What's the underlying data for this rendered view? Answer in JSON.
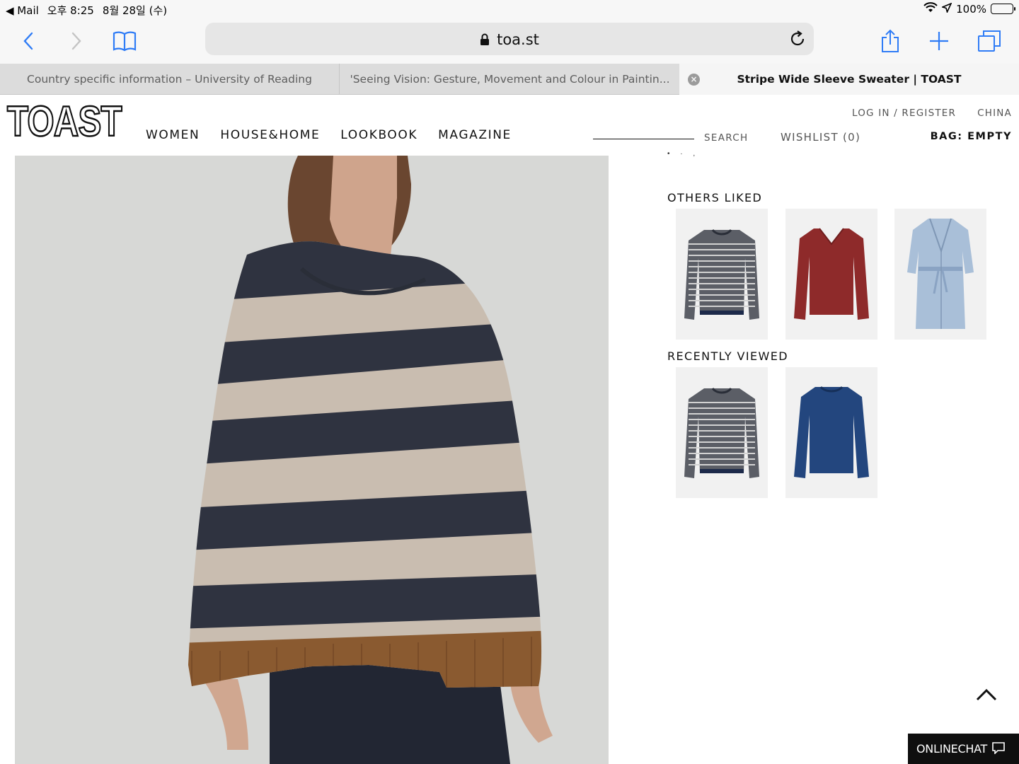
{
  "status_bar": {
    "back_app": "◀ Mail",
    "time": "오후 8:25",
    "date": "8월 28일 (수)",
    "battery": "100%"
  },
  "browser": {
    "url": "toa.st",
    "tabs": [
      {
        "label": "Country specific information – University of Reading"
      },
      {
        "label": "'Seeing Vision: Gesture, Movement and Colour in Paintin..."
      },
      {
        "label": "Stripe Wide Sleeve Sweater | TOAST",
        "active": true
      }
    ]
  },
  "site": {
    "logo": "TOAST",
    "nav": [
      "WOMEN",
      "HOUSE&HOME",
      "LOOKBOOK",
      "MAGAZINE"
    ],
    "utility": {
      "login": "LOG IN / REGISTER",
      "region": "CHINA"
    },
    "search_label": "SEARCH",
    "wishlist": "WISHLIST (0)",
    "bag": "BAG: EMPTY"
  },
  "product": {
    "colors": {
      "navy": "#2f3340",
      "oat": "#c9bdb0",
      "rib": "#8a5a30"
    }
  },
  "others_liked": {
    "title": "OTHERS LIKED",
    "items": [
      {
        "icon": "striped-sweater",
        "color": "#5b5e66"
      },
      {
        "icon": "red-sweater",
        "color": "#8e2a2a"
      },
      {
        "icon": "blue-robe-dress",
        "color": "#a9bfd8"
      }
    ]
  },
  "recently_viewed": {
    "title": "RECENTLY VIEWED",
    "items": [
      {
        "icon": "striped-sweater",
        "color": "#5b5e66"
      },
      {
        "icon": "blue-sweater",
        "color": "#23467e"
      }
    ]
  },
  "chat": {
    "label": "ONLINECHAT"
  }
}
